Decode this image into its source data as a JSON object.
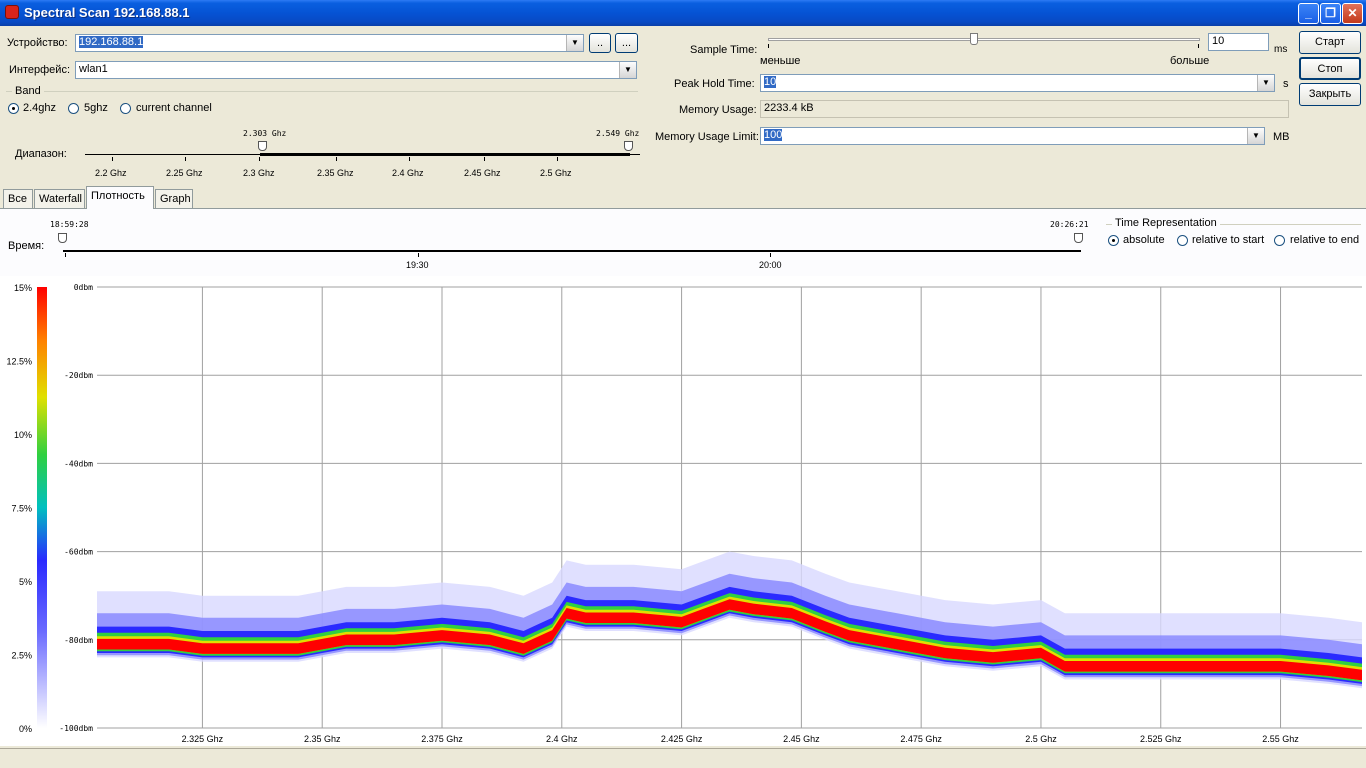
{
  "window": {
    "title": "Spectral Scan 192.168.88.1"
  },
  "form": {
    "device_label": "Устройство:",
    "device_value": "192.168.88.1",
    "device_btn1": "..",
    "device_btn2": "...",
    "interface_label": "Интерфейс:",
    "interface_value": "wlan1",
    "band_label": "Band",
    "band_options": [
      "2.4ghz",
      "5ghz",
      "current channel"
    ],
    "band_selected": "2.4ghz",
    "range_label": "Диапазон:",
    "range_start": "2.303 Ghz",
    "range_end": "2.549 Ghz",
    "range_ticks": [
      "2.2 Ghz",
      "2.25 Ghz",
      "2.3 Ghz",
      "2.35 Ghz",
      "2.4 Ghz",
      "2.45 Ghz",
      "2.5 Ghz"
    ]
  },
  "settings": {
    "sample_time_label": "Sample Time:",
    "sample_time_value": "10",
    "sample_time_unit": "ms",
    "slider_less": "меньше",
    "slider_more": "больше",
    "sample_slider_fraction": 0.48,
    "peak_hold_label": "Peak Hold Time:",
    "peak_hold_value": "10",
    "peak_hold_unit": "s",
    "memory_usage_label": "Memory Usage:",
    "memory_usage_value": "2233.4 kB",
    "memory_limit_label": "Memory Usage Limit:",
    "memory_limit_value": "100",
    "memory_limit_unit": "MB"
  },
  "buttons": {
    "start": "Старт",
    "stop": "Стоп",
    "close": "Закрыть"
  },
  "tabs": [
    "Все",
    "Waterfall",
    "Плотность",
    "Graph"
  ],
  "active_tab": "Плотность",
  "time": {
    "label": "Время:",
    "start": "18:59:28",
    "end": "20:26:21",
    "ticks": [
      "19:30",
      "20:00"
    ],
    "representation_label": "Time Representation",
    "rep_options": [
      "absolute",
      "relative to start",
      "relative to end"
    ],
    "rep_selected": "absolute"
  },
  "colors": {
    "titlebar": "#0553d4",
    "selection": "#316ac5",
    "scale": [
      "#ffffff",
      "#6a6aff",
      "#2a2aff",
      "#00c0c0",
      "#30d040",
      "#e0e000",
      "#ff8000",
      "#ff0000"
    ]
  },
  "chart_data": {
    "type": "heatmap",
    "title": "",
    "xlabel": "",
    "ylabel": "",
    "x_ticks": [
      "2.325 Ghz",
      "2.35 Ghz",
      "2.375 Ghz",
      "2.4 Ghz",
      "2.425 Ghz",
      "2.45 Ghz",
      "2.475 Ghz",
      "2.5 Ghz",
      "2.525 Ghz",
      "2.55 Ghz"
    ],
    "x_tick_values": [
      2.325,
      2.35,
      2.375,
      2.4,
      2.425,
      2.45,
      2.475,
      2.5,
      2.525,
      2.55
    ],
    "xlim": [
      2.303,
      2.567
    ],
    "y_ticks": [
      "0dbm",
      "-20dbm",
      "-40dbm",
      "-60dbm",
      "-80dbm",
      "-100dbm"
    ],
    "ylim": [
      -100,
      0
    ],
    "color_scale_ticks": [
      "15%",
      "12.5%",
      "10%",
      "7.5%",
      "5%",
      "2.5%",
      "0%"
    ],
    "grid": true,
    "peak_trace": [
      {
        "freq": 2.303,
        "dbm": -81
      },
      {
        "freq": 2.31,
        "dbm": -81
      },
      {
        "freq": 2.318,
        "dbm": -81
      },
      {
        "freq": 2.325,
        "dbm": -82
      },
      {
        "freq": 2.335,
        "dbm": -82
      },
      {
        "freq": 2.345,
        "dbm": -82
      },
      {
        "freq": 2.355,
        "dbm": -80
      },
      {
        "freq": 2.365,
        "dbm": -80
      },
      {
        "freq": 2.375,
        "dbm": -79
      },
      {
        "freq": 2.385,
        "dbm": -80
      },
      {
        "freq": 2.392,
        "dbm": -82
      },
      {
        "freq": 2.398,
        "dbm": -79
      },
      {
        "freq": 2.401,
        "dbm": -74
      },
      {
        "freq": 2.405,
        "dbm": -75
      },
      {
        "freq": 2.415,
        "dbm": -75
      },
      {
        "freq": 2.425,
        "dbm": -76
      },
      {
        "freq": 2.43,
        "dbm": -74
      },
      {
        "freq": 2.435,
        "dbm": -72
      },
      {
        "freq": 2.44,
        "dbm": -73
      },
      {
        "freq": 2.448,
        "dbm": -74
      },
      {
        "freq": 2.455,
        "dbm": -77
      },
      {
        "freq": 2.46,
        "dbm": -79
      },
      {
        "freq": 2.47,
        "dbm": -81
      },
      {
        "freq": 2.48,
        "dbm": -83
      },
      {
        "freq": 2.49,
        "dbm": -84
      },
      {
        "freq": 2.5,
        "dbm": -83
      },
      {
        "freq": 2.505,
        "dbm": -86
      },
      {
        "freq": 2.52,
        "dbm": -86
      },
      {
        "freq": 2.53,
        "dbm": -86
      },
      {
        "freq": 2.54,
        "dbm": -86
      },
      {
        "freq": 2.55,
        "dbm": -86
      },
      {
        "freq": 2.56,
        "dbm": -87
      },
      {
        "freq": 2.567,
        "dbm": -88
      }
    ]
  }
}
